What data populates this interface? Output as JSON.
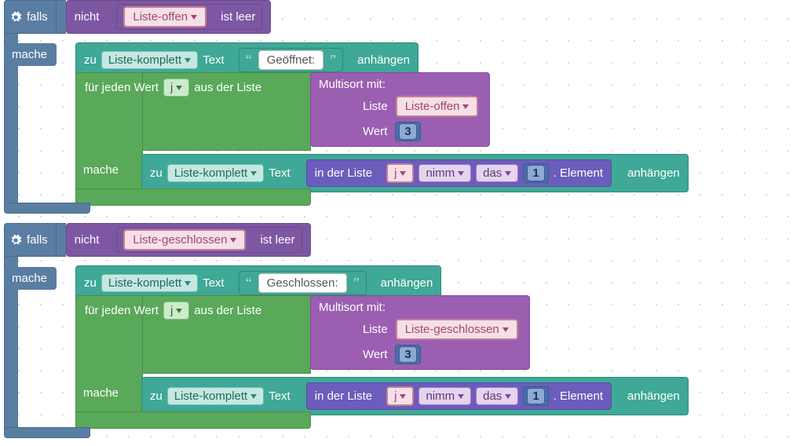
{
  "kw": {
    "falls": "falls",
    "mache": "mache",
    "nicht": "nicht",
    "ist_leer": "ist leer",
    "zu": "zu",
    "text": "Text",
    "anhaengen": "anhängen",
    "fuer_jeden_wert": "für jeden Wert",
    "aus_der_liste": "aus der Liste",
    "multisort_mit": "Multisort  mit:",
    "liste": "Liste",
    "wert": "Wert",
    "in_der_liste": "in der Liste",
    "nimm": "nimm",
    "das": "das",
    "element": ".  Element"
  },
  "vars": {
    "liste_offen": "Liste-offen",
    "liste_geschlossen": "Liste-geschlossen",
    "liste_komplett": "Liste-komplett",
    "j": "j"
  },
  "lits": {
    "geoeffnet": "Geöffnet:",
    "geschlossen": "Geschlossen:",
    "drei": "3",
    "eins": "1"
  },
  "cond_block1": {
    "not_var": "Liste-offen",
    "append_text": "Geöffnet:",
    "multisort_list": "Liste-offen",
    "multisort_wert": "3",
    "loop_var": "j",
    "get_index": "1"
  },
  "cond_block2": {
    "not_var": "Liste-geschlossen",
    "append_text": "Geschlossen:",
    "multisort_list": "Liste-geschlossen",
    "multisort_wert": "3",
    "loop_var": "j",
    "get_index": "1"
  },
  "chart_data": {
    "type": "table",
    "note": "Blockly-style visual program (German locale)",
    "structure": [
      {
        "if": "not (Liste-offen is empty)",
        "do": [
          "append text 'Geöffnet:' to Liste-komplett",
          {
            "for_each": "j in Multisort(Liste=Liste-offen, Wert=3)",
            "do": [
              "append (in list j get the 1st element) to Liste-komplett"
            ]
          }
        ]
      },
      {
        "if": "not (Liste-geschlossen is empty)",
        "do": [
          "append text 'Geschlossen:' to Liste-komplett",
          {
            "for_each": "j in Multisort(Liste=Liste-geschlossen, Wert=3)",
            "do": [
              "append (in list j get the 1st element) to Liste-komplett"
            ]
          }
        ]
      }
    ]
  }
}
